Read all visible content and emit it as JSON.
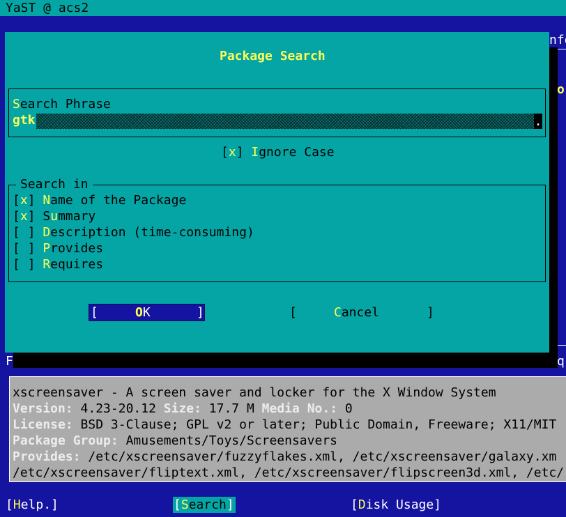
{
  "window": {
    "title": "YaST @ acs2"
  },
  "background_fragments": {
    "right_top": "nfo",
    "right_mid": "o",
    "left_bottom": "F",
    "right_bottom": "q"
  },
  "dialog": {
    "title": "Package Search",
    "search_label_hot": "S",
    "search_label_rest": "earch Phrase",
    "search_value": "gtk",
    "ignore_case": {
      "box_open": "[",
      "mark": "x",
      "box_close": "]",
      "hot": "I",
      "rest": "gnore Case",
      "checked": true
    },
    "search_in": {
      "legend": "Search in",
      "options": [
        {
          "mark": "x",
          "hot": "N",
          "rest": "ame of the Package",
          "checked": true
        },
        {
          "mark": "x",
          "hot": "u",
          "pre": "S",
          "rest": "mmary",
          "checked": true
        },
        {
          "mark": " ",
          "hot": "D",
          "rest": "escription (time-consuming)",
          "checked": false
        },
        {
          "mark": " ",
          "hot": "P",
          "rest": "rovides",
          "checked": false
        },
        {
          "mark": " ",
          "hot": "R",
          "rest": "equires",
          "checked": false
        }
      ]
    },
    "ok": {
      "open": "[",
      "hot": "O",
      "rest": "K",
      "close": "]"
    },
    "cancel": {
      "open": "[",
      "hot": "C",
      "rest": "ancel",
      "close": "]"
    }
  },
  "package_info": {
    "heading": "xscreensaver - A screen saver and locker for the X Window System",
    "version_label": "Version:",
    "version": "4.23-20.12",
    "size_label": "Size:",
    "size": "17.7 M",
    "media_label": "Media No.:",
    "media": "0",
    "license_label": "License:",
    "license": "BSD 3-Clause; GPL v2 or later; Public Domain, Freeware; X11/MIT",
    "group_label": "Package Group:",
    "group": "Amusements/Toys/Screensavers",
    "provides_label": "Provides:",
    "provides_1": "/etc/xscreensaver/fuzzyflakes.xml, /etc/xscreensaver/galaxy.xm",
    "provides_2": "/etc/xscreensaver/fliptext.xml, /etc/xscreensaver/flipscreen3d.xml, /etc/"
  },
  "bottom_bar": {
    "help": {
      "open": "[",
      "hot": "H",
      "rest": "elp.",
      "close": "]"
    },
    "search": {
      "open": "[",
      "hot": "S",
      "rest": "earch",
      "close": "]"
    },
    "disk": {
      "open": "[",
      "hot": "D",
      "rest": "isk Usage",
      "close": "]"
    }
  },
  "colors": {
    "background": "#1414a0",
    "dialog": "#06a5a5",
    "hotkey": "#ffff54",
    "info_panel": "#ababab"
  }
}
